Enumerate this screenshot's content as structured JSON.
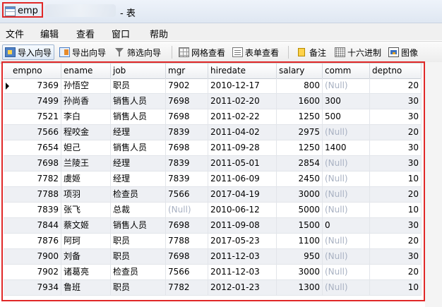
{
  "window": {
    "table_name": "emp",
    "title_suffix": "- 表"
  },
  "menu": [
    "文件",
    "编辑",
    "查看",
    "窗口",
    "帮助"
  ],
  "toolbar": [
    {
      "label": "导入向导",
      "icon": "import-icon"
    },
    {
      "label": "导出向导",
      "icon": "export-icon"
    },
    {
      "label": "筛选向导",
      "icon": "filter-icon"
    },
    {
      "label": "网格查看",
      "icon": "grid-view-icon"
    },
    {
      "label": "表单查看",
      "icon": "form-view-icon"
    },
    {
      "label": "备注",
      "icon": "note-icon"
    },
    {
      "label": "十六进制",
      "icon": "hex-icon"
    },
    {
      "label": "图像",
      "icon": "image-icon"
    }
  ],
  "columns": [
    "empno",
    "ename",
    "job",
    "mgr",
    "hiredate",
    "salary",
    "comm",
    "deptno"
  ],
  "null_text": "(Null)",
  "rows": [
    [
      "7369",
      "孙悟空",
      "职员",
      "7902",
      "2010-12-17",
      "800",
      "(Null)",
      "20"
    ],
    [
      "7499",
      "孙尚香",
      "销售人员",
      "7698",
      "2011-02-20",
      "1600",
      "300",
      "30"
    ],
    [
      "7521",
      "李白",
      "销售人员",
      "7698",
      "2011-02-22",
      "1250",
      "500",
      "30"
    ],
    [
      "7566",
      "程咬金",
      "经理",
      "7839",
      "2011-04-02",
      "2975",
      "(Null)",
      "20"
    ],
    [
      "7654",
      "妲己",
      "销售人员",
      "7698",
      "2011-09-28",
      "1250",
      "1400",
      "30"
    ],
    [
      "7698",
      "兰陵王",
      "经理",
      "7839",
      "2011-05-01",
      "2854",
      "(Null)",
      "30"
    ],
    [
      "7782",
      "虞姬",
      "经理",
      "7839",
      "2011-06-09",
      "2450",
      "(Null)",
      "10"
    ],
    [
      "7788",
      "项羽",
      "检查员",
      "7566",
      "2017-04-19",
      "3000",
      "(Null)",
      "20"
    ],
    [
      "7839",
      "张飞",
      "总裁",
      "(Null)",
      "2010-06-12",
      "5000",
      "(Null)",
      "10"
    ],
    [
      "7844",
      "蔡文姬",
      "销售人员",
      "7698",
      "2011-09-08",
      "1500",
      "0",
      "30"
    ],
    [
      "7876",
      "阿珂",
      "职员",
      "7788",
      "2017-05-23",
      "1100",
      "(Null)",
      "20"
    ],
    [
      "7900",
      "刘备",
      "职员",
      "7698",
      "2011-12-03",
      "950",
      "(Null)",
      "30"
    ],
    [
      "7902",
      "诸葛亮",
      "检查员",
      "7566",
      "2011-12-03",
      "3000",
      "(Null)",
      "20"
    ],
    [
      "7934",
      "鲁班",
      "职员",
      "7782",
      "2012-01-23",
      "1300",
      "(Null)",
      "10"
    ]
  ],
  "colors": {
    "highlight": "#e02828",
    "null_text": "#a8b1c2",
    "alt_row": "#eef0f4"
  }
}
